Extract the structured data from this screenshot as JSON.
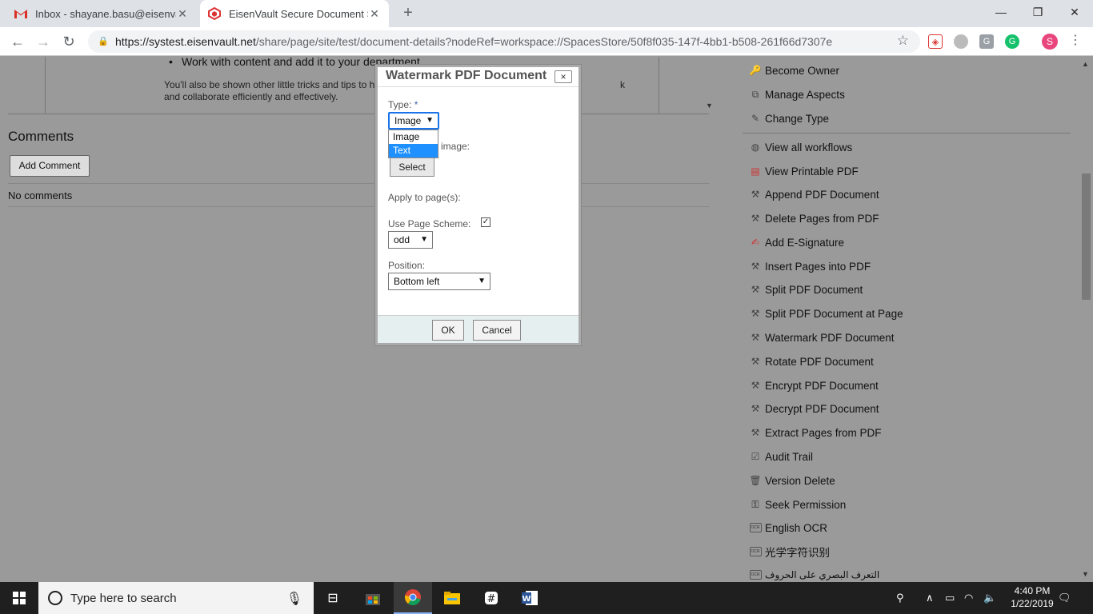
{
  "browser": {
    "tabs": [
      {
        "title": "Inbox - shayane.basu@eisenvault",
        "active": false
      },
      {
        "title": "EisenVault Secure Document Stor",
        "active": true
      }
    ],
    "url_host": "https://systest.eisenvault.net",
    "url_path": "/share/page/site/test/document-details?nodeRef=workspace://SpacesStore/50f8f035-147f-4bb1-b508-261f66d7307e",
    "profile_initial": "S"
  },
  "page": {
    "bullet": "Work with content and add it to your department",
    "tips_line1": "You'll also be shown other little tricks and tips to help you",
    "tips_tail": "k",
    "tips_line2": "and collaborate efficiently and effectively.",
    "comments_heading": "Comments",
    "add_comment_label": "Add Comment",
    "no_comments": "No comments"
  },
  "actions": {
    "group1": [
      {
        "label": "Become Owner",
        "icon": "key-icon"
      },
      {
        "label": "Manage Aspects",
        "icon": "aspects-icon"
      },
      {
        "label": "Change Type",
        "icon": "pencil-icon"
      }
    ],
    "group2": [
      {
        "label": "View all workflows",
        "icon": "workflow-icon"
      },
      {
        "label": "View Printable PDF",
        "icon": "pdf-icon"
      },
      {
        "label": "Append PDF Document",
        "icon": "pdf-tools-icon"
      },
      {
        "label": "Delete Pages from PDF",
        "icon": "pdf-tools-icon"
      },
      {
        "label": "Add E-Signature",
        "icon": "signature-icon"
      },
      {
        "label": "Insert Pages into PDF",
        "icon": "pdf-tools-icon"
      },
      {
        "label": "Split PDF Document",
        "icon": "pdf-tools-icon"
      },
      {
        "label": "Split PDF Document at Page",
        "icon": "pdf-tools-icon"
      },
      {
        "label": "Watermark PDF Document",
        "icon": "pdf-tools-icon"
      },
      {
        "label": "Rotate PDF Document",
        "icon": "pdf-tools-icon"
      },
      {
        "label": "Encrypt PDF Document",
        "icon": "pdf-tools-icon"
      },
      {
        "label": "Decrypt PDF Document",
        "icon": "pdf-tools-icon"
      },
      {
        "label": "Extract Pages from PDF",
        "icon": "pdf-tools-icon"
      },
      {
        "label": "Audit Trail",
        "icon": "audit-icon"
      },
      {
        "label": "Version Delete",
        "icon": "trash-icon"
      },
      {
        "label": "Seek Permission",
        "icon": "permission-icon"
      },
      {
        "label": "English OCR",
        "icon": "ocr-icon"
      },
      {
        "label": "光学字符识别",
        "icon": "ocr-icon"
      },
      {
        "label": "التعرف البصري على الحروف",
        "icon": "ocr-icon"
      }
    ]
  },
  "dialog": {
    "title": "Watermark PDF Document",
    "close": "×",
    "type_label": "Type:",
    "required_mark": "*",
    "type_value": "Image",
    "type_options": [
      "Image",
      "Text"
    ],
    "type_highlighted": "Text",
    "image_label": "image:",
    "select_button": "Select",
    "apply_pages_label": "Apply to page(s):",
    "use_scheme_label": "Use Page Scheme:",
    "use_scheme_checked": true,
    "scheme_value": "odd",
    "position_label": "Position:",
    "position_value": "Bottom left",
    "ok_label": "OK",
    "cancel_label": "Cancel"
  },
  "taskbar": {
    "search_placeholder": "Type here to search",
    "time": "4:40 PM",
    "date": "1/22/2019"
  }
}
